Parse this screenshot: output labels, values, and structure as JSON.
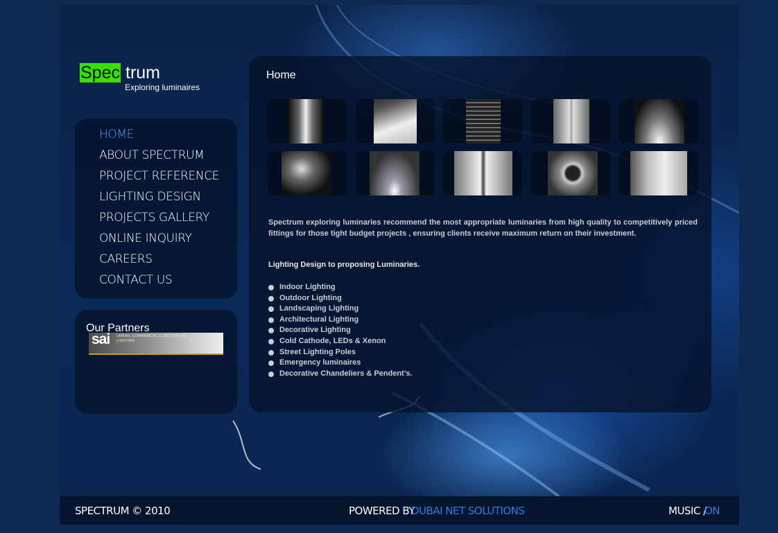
{
  "logo": {
    "spec": "Spec",
    "trum": "trum",
    "tagline": "Exploring luminaires"
  },
  "nav": {
    "items": [
      {
        "label": "HOME",
        "active": true
      },
      {
        "label": "ABOUT SPECTRUM",
        "active": false
      },
      {
        "label": "PROJECT REFERENCE",
        "active": false
      },
      {
        "label": "LIGHTING DESIGN",
        "active": false
      },
      {
        "label": "PROJECTS GALLERY",
        "active": false
      },
      {
        "label": "ONLINE INQUIRY",
        "active": false
      },
      {
        "label": "CAREERS",
        "active": false
      },
      {
        "label": "CONTACT US",
        "active": false
      }
    ]
  },
  "partners": {
    "title": "Our Partners",
    "logo_text": "sai",
    "logo_subtext": "URBAN, COMMERCIAL & DECORATIVE LIGHTING"
  },
  "main": {
    "title": "Home",
    "description": "Spectrum exploring luminaries recommend the most appropriate luminaries from high quality to competitively priced fittings for those tight budget projects , ensuring clients receive maximum return on their investment.",
    "subheading": "Lighting Design to proposing Luminaries.",
    "services": [
      "Indoor Lighting",
      "Outdoor Lighting",
      "Landscaping Lighting",
      "Architectural Lighting",
      "Decorative Lighting",
      "Cold Cathode, LEDs & Xenon",
      "Street Lighting Poles",
      "Emergency luminaires",
      "Decorative Chandeliers & Pendent's."
    ]
  },
  "footer": {
    "copyright": "SPECTRUM © 2010",
    "powered_prefix": "POWERED BY",
    "powered_link": "DUBAI NET SOLUTIONS",
    "music_label": "MUSIC /",
    "music_state": "ON"
  },
  "colors": {
    "accent": "#4aa2ff",
    "logo_green": "#33e300",
    "background": "#0b2a58"
  }
}
